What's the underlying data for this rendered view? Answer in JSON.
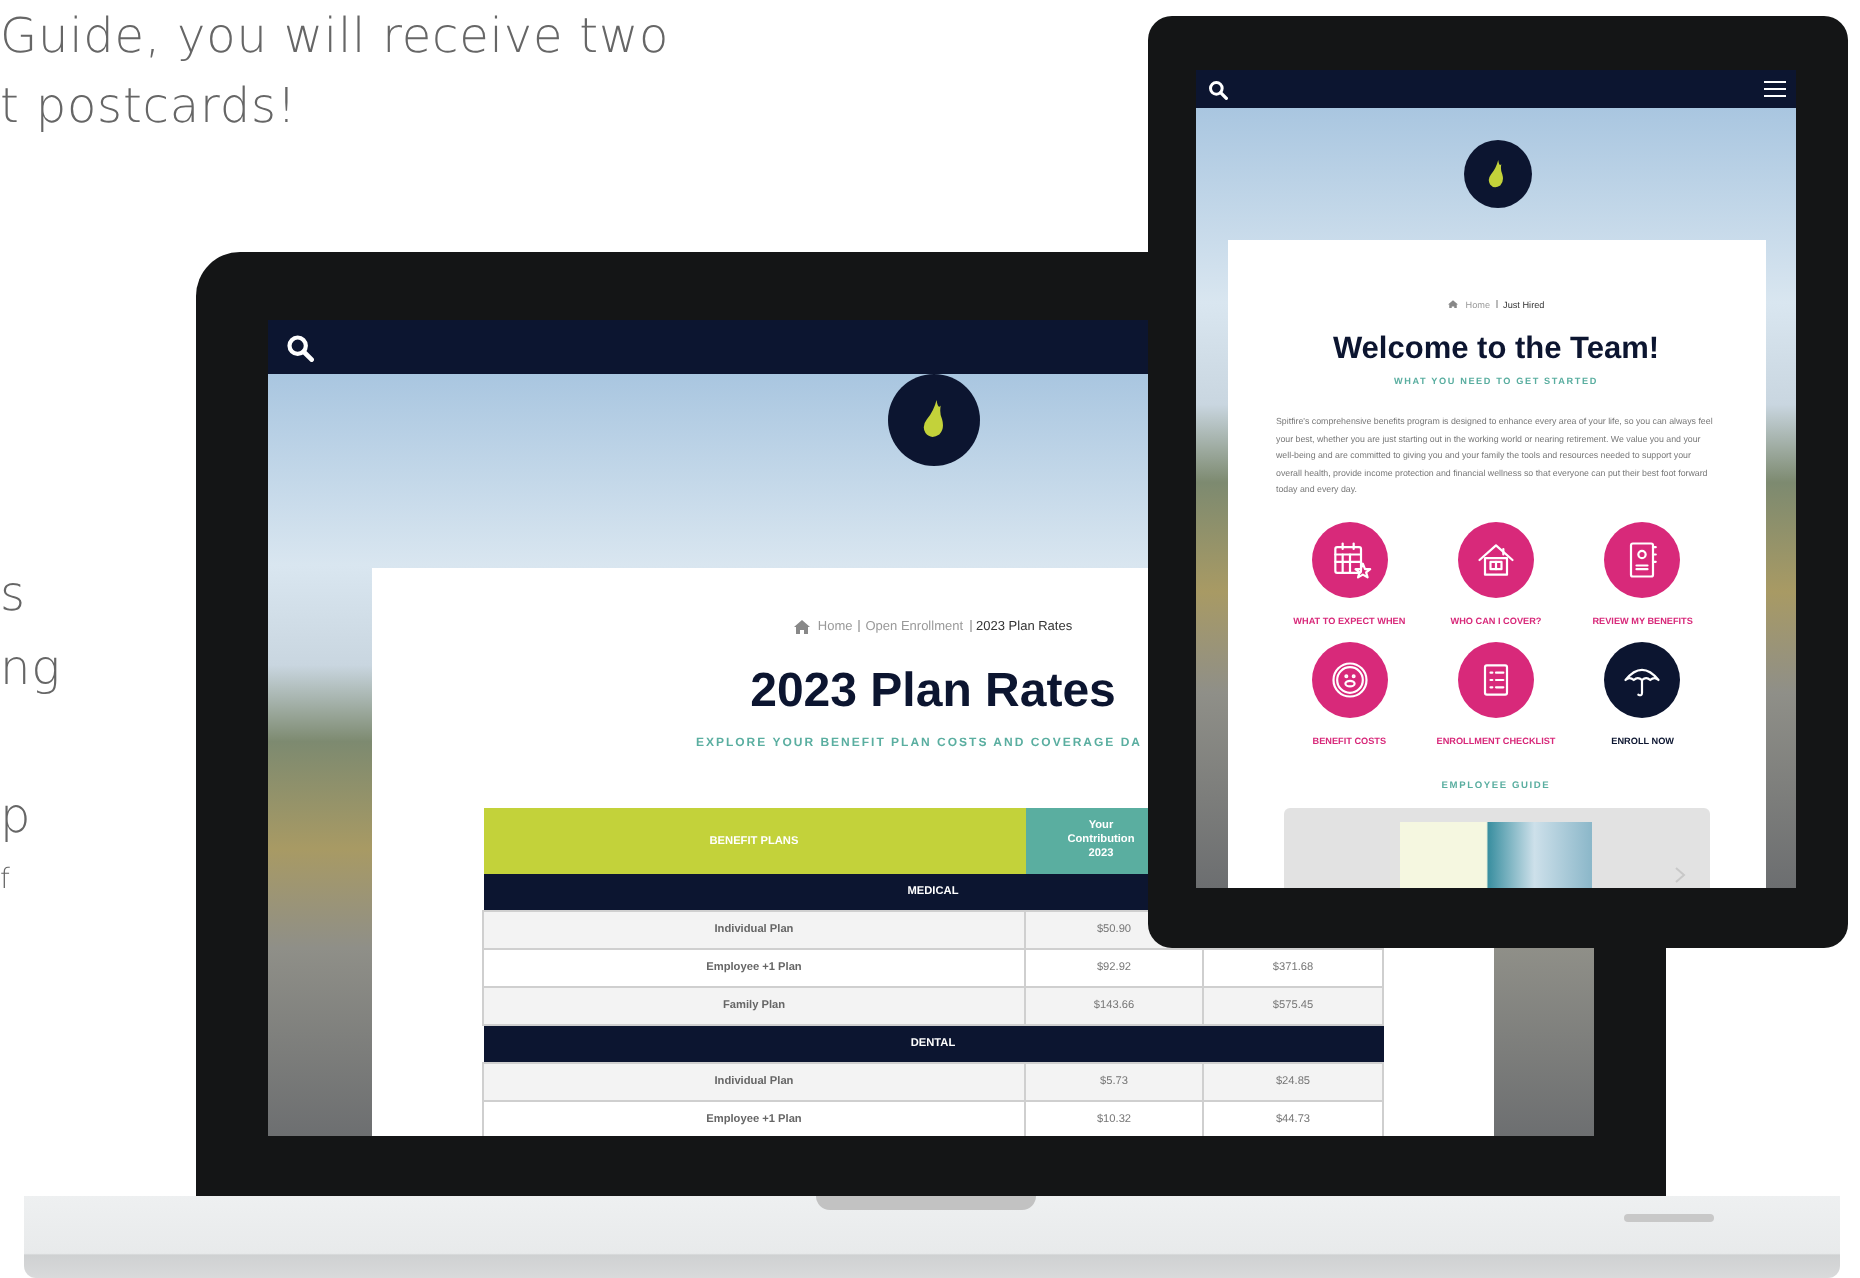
{
  "intro": {
    "lines": [
      "Guide, you will receive two",
      "t postcards!"
    ],
    "fragments": [
      "s",
      "ng",
      "p",
      "f"
    ]
  },
  "laptop": {
    "breadcrumb": [
      {
        "label": "Home",
        "current": false
      },
      {
        "label": "Open Enrollment",
        "current": false
      },
      {
        "label": "2023 Plan Rates",
        "current": true
      }
    ],
    "title": "2023 Plan Rates",
    "subtitle": "EXPLORE YOUR BENEFIT PLAN COSTS AND COVERAGE DA",
    "table": {
      "columns": [
        "BENEFIT PLANS",
        "Your Contribution 2023"
      ],
      "sections": [
        {
          "title": "MEDICAL",
          "rows": [
            {
              "plan": "Individual Plan",
              "column_2": "$50.90"
            },
            {
              "plan": "Employee +1 Plan",
              "column_2": "$92.92",
              "column_3": "$371.68"
            },
            {
              "plan": "Family Plan",
              "column_2": "$143.66",
              "column_3": "$575.45"
            }
          ]
        },
        {
          "title": "DENTAL",
          "rows": [
            {
              "plan": "Individual Plan",
              "column_2": "$5.73",
              "column_3": "$24.85"
            },
            {
              "plan": "Employee +1 Plan",
              "column_2": "$10.32",
              "column_3": "$44.73"
            }
          ]
        }
      ]
    }
  },
  "tablet": {
    "breadcrumb": [
      {
        "label": "Home",
        "current": false
      },
      {
        "label": "Just Hired",
        "current": true
      }
    ],
    "title": "Welcome to the Team!",
    "subtitle": "WHAT YOU NEED TO GET STARTED",
    "paragraph": "Spitfire's comprehensive benefits program is designed to enhance every area of your life, so you can always feel your best, whether you are just starting out in the working world or nearing retirement. We value you and your well-being and are committed to giving you and your family the tools and resources needed to support your overall health, provide income protection and financial wellness so that everyone can put their best foot forward today and every day.",
    "tiles": [
      {
        "label": "WHAT TO EXPECT WHEN",
        "color": "#d8297a"
      },
      {
        "label": "WHO CAN I COVER?",
        "color": "#d8297a"
      },
      {
        "label": "REVIEW MY BENEFITS",
        "color": "#d8297a"
      },
      {
        "label": "BENEFIT COSTS",
        "color": "#d8297a"
      },
      {
        "label": "ENROLLMENT CHECKLIST",
        "color": "#d8297a"
      },
      {
        "label": "ENROLL NOW",
        "color": "#0c1530"
      }
    ],
    "guide_heading": "EMPLOYEE GUIDE"
  }
}
